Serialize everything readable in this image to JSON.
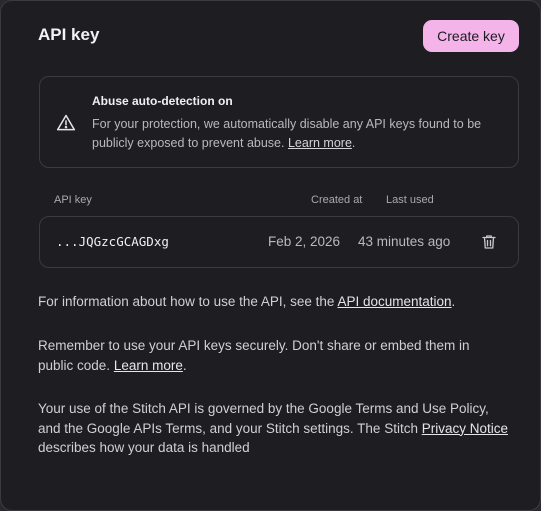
{
  "header": {
    "title": "API key",
    "create_label": "Create key"
  },
  "alert": {
    "icon": "warning-triangle-icon",
    "title": "Abuse auto-detection on",
    "body": "For your protection, we automatically disable any API keys found to be publicly exposed to prevent abuse.",
    "link": "Learn more",
    "suffix": "."
  },
  "table": {
    "columns": {
      "key": "API key",
      "created": "Created at",
      "used": "Last used"
    },
    "rows": [
      {
        "key": "...JQGzcGCAGDxg",
        "created": "Feb 2, 2026",
        "used": "43 minutes ago",
        "action_icon": "trash-icon"
      }
    ]
  },
  "info": [
    {
      "prefix": "For information about how to use the API, see the ",
      "link": "API documentation",
      "suffix": "."
    },
    {
      "prefix": "Remember to use your API keys securely. Don't share or embed them in public code. ",
      "link": "Learn more",
      "suffix": "."
    },
    {
      "prefix": "Your use of the Stitch API is governed by the Google Terms and Use Policy, and the Google APIs Terms, and your Stitch settings. The Stitch ",
      "link": "Privacy Notice",
      "suffix": " describes how your data is handled"
    }
  ],
  "colors": {
    "accent": "#f4b4ea",
    "background": "#1e1e22",
    "border": "#3a3a40"
  }
}
